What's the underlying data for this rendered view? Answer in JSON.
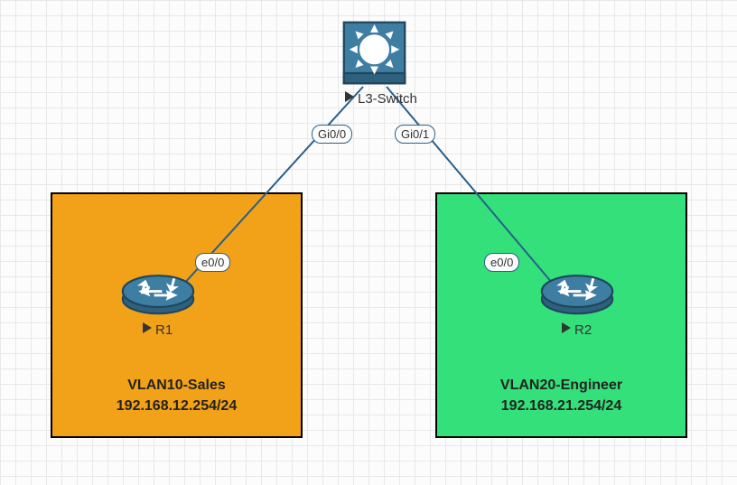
{
  "switch": {
    "label": "L3-Switch",
    "ports": {
      "left": "Gi0/0",
      "right": "Gi0/1"
    }
  },
  "r1": {
    "label": "R1",
    "port": "e0/0"
  },
  "r2": {
    "label": "R2",
    "port": "e0/0"
  },
  "vlan10": {
    "title": "VLAN10-Sales",
    "gateway": "192.168.12.254/24"
  },
  "vlan20": {
    "title": "VLAN20-Engineer",
    "gateway": "192.168.21.254/24"
  }
}
